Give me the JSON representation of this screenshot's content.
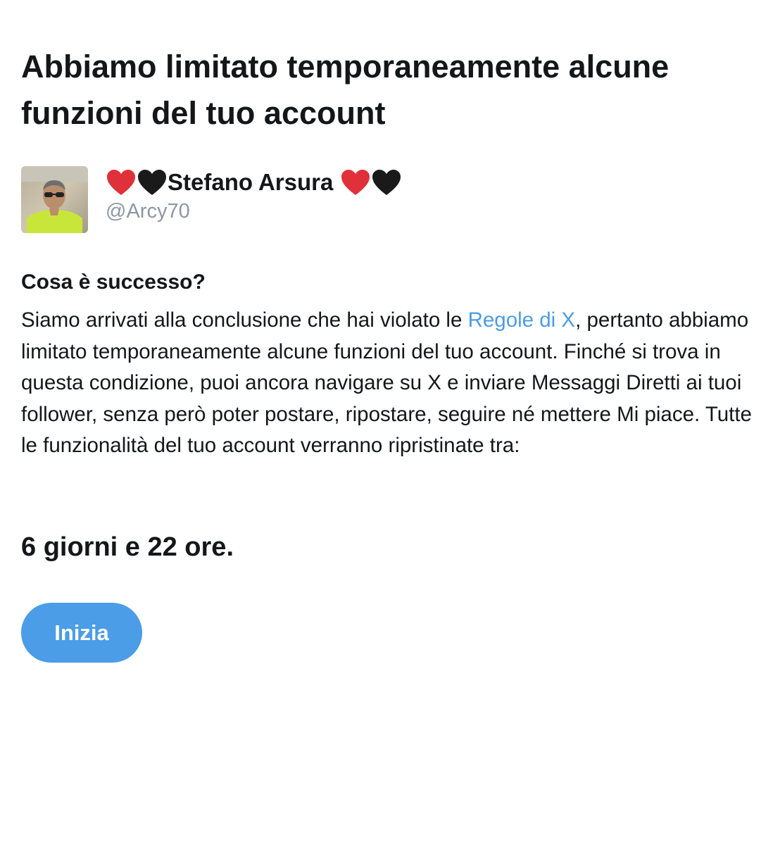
{
  "header": {
    "title": "Abbiamo limitato temporaneamente alcune funzioni del tuo account"
  },
  "user": {
    "display_name": "Stefano Arsura",
    "handle": "@Arcy70",
    "name_prefix_emoji": [
      "red-heart",
      "black-heart"
    ],
    "name_suffix_emoji": [
      "red-heart",
      "black-heart"
    ]
  },
  "notice": {
    "heading": "Cosa è successo?",
    "text_before_link": "Siamo arrivati alla conclusione che hai violato le ",
    "link_label": "Regole di X",
    "text_after_link": ", pertanto abbiamo limitato temporaneamente alcune funzioni del tuo account. Finché si trova in questa condizione, puoi ancora navigare su X e inviare Messaggi Diretti ai tuoi follower, senza però poter postare, ripostare, seguire né mettere Mi piace. Tutte le funzionalità del tuo account verranno ripristinate tra:",
    "duration": "6 giorni e 22 ore."
  },
  "actions": {
    "start_label": "Inizia"
  },
  "colors": {
    "accent": "#4a9de6",
    "text": "#14171a",
    "muted": "#8b98a5",
    "red_heart": "#e0303a",
    "black_heart": "#1a1a1a"
  }
}
